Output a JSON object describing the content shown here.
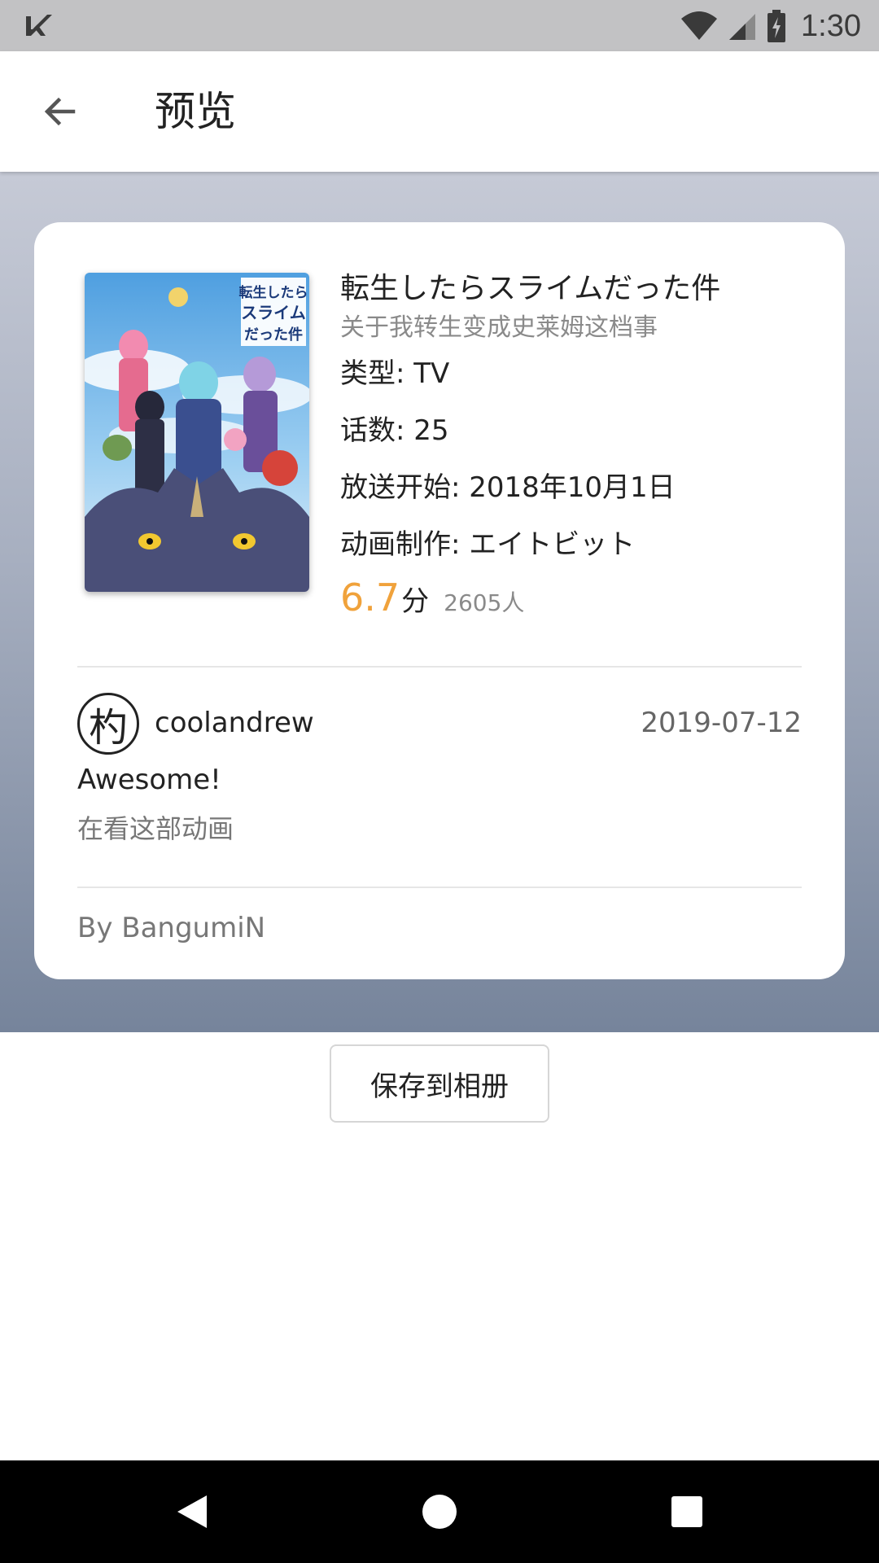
{
  "status_bar": {
    "time": "1:30",
    "icons": [
      "notification-check-icon",
      "wifi-icon",
      "signal-icon",
      "battery-charging-icon"
    ]
  },
  "app_bar": {
    "title": "预览",
    "back_icon": "arrow-back-icon"
  },
  "card": {
    "cover_title_art": "転生したらスライムだった件",
    "title_jp": "転生したらスライムだった件",
    "title_cn": "关于我转生变成史莱姆这档事",
    "type": "类型: TV",
    "episodes": "话数: 25",
    "air_start": "放送开始: 2018年10月1日",
    "studio": "动画制作: エイトビット",
    "score": "6.7",
    "score_unit": "分",
    "rating_count": "2605人",
    "user": {
      "avatar_char": "杓",
      "name": "coolandrew",
      "date": "2019-07-12"
    },
    "comment": "Awesome!",
    "watch_status": "在看这部动画",
    "credit": "By BangumiN"
  },
  "actions": {
    "save_label": "保存到相册"
  },
  "colors": {
    "score": "#f0a23b",
    "gradient_top": "#c6cad6",
    "gradient_bottom": "#76849b",
    "status_bar": "#c2c2c4",
    "nav_bar": "#000000"
  },
  "nav_bar": {
    "icons": [
      "back-triangle-icon",
      "home-circle-icon",
      "recents-square-icon"
    ]
  }
}
